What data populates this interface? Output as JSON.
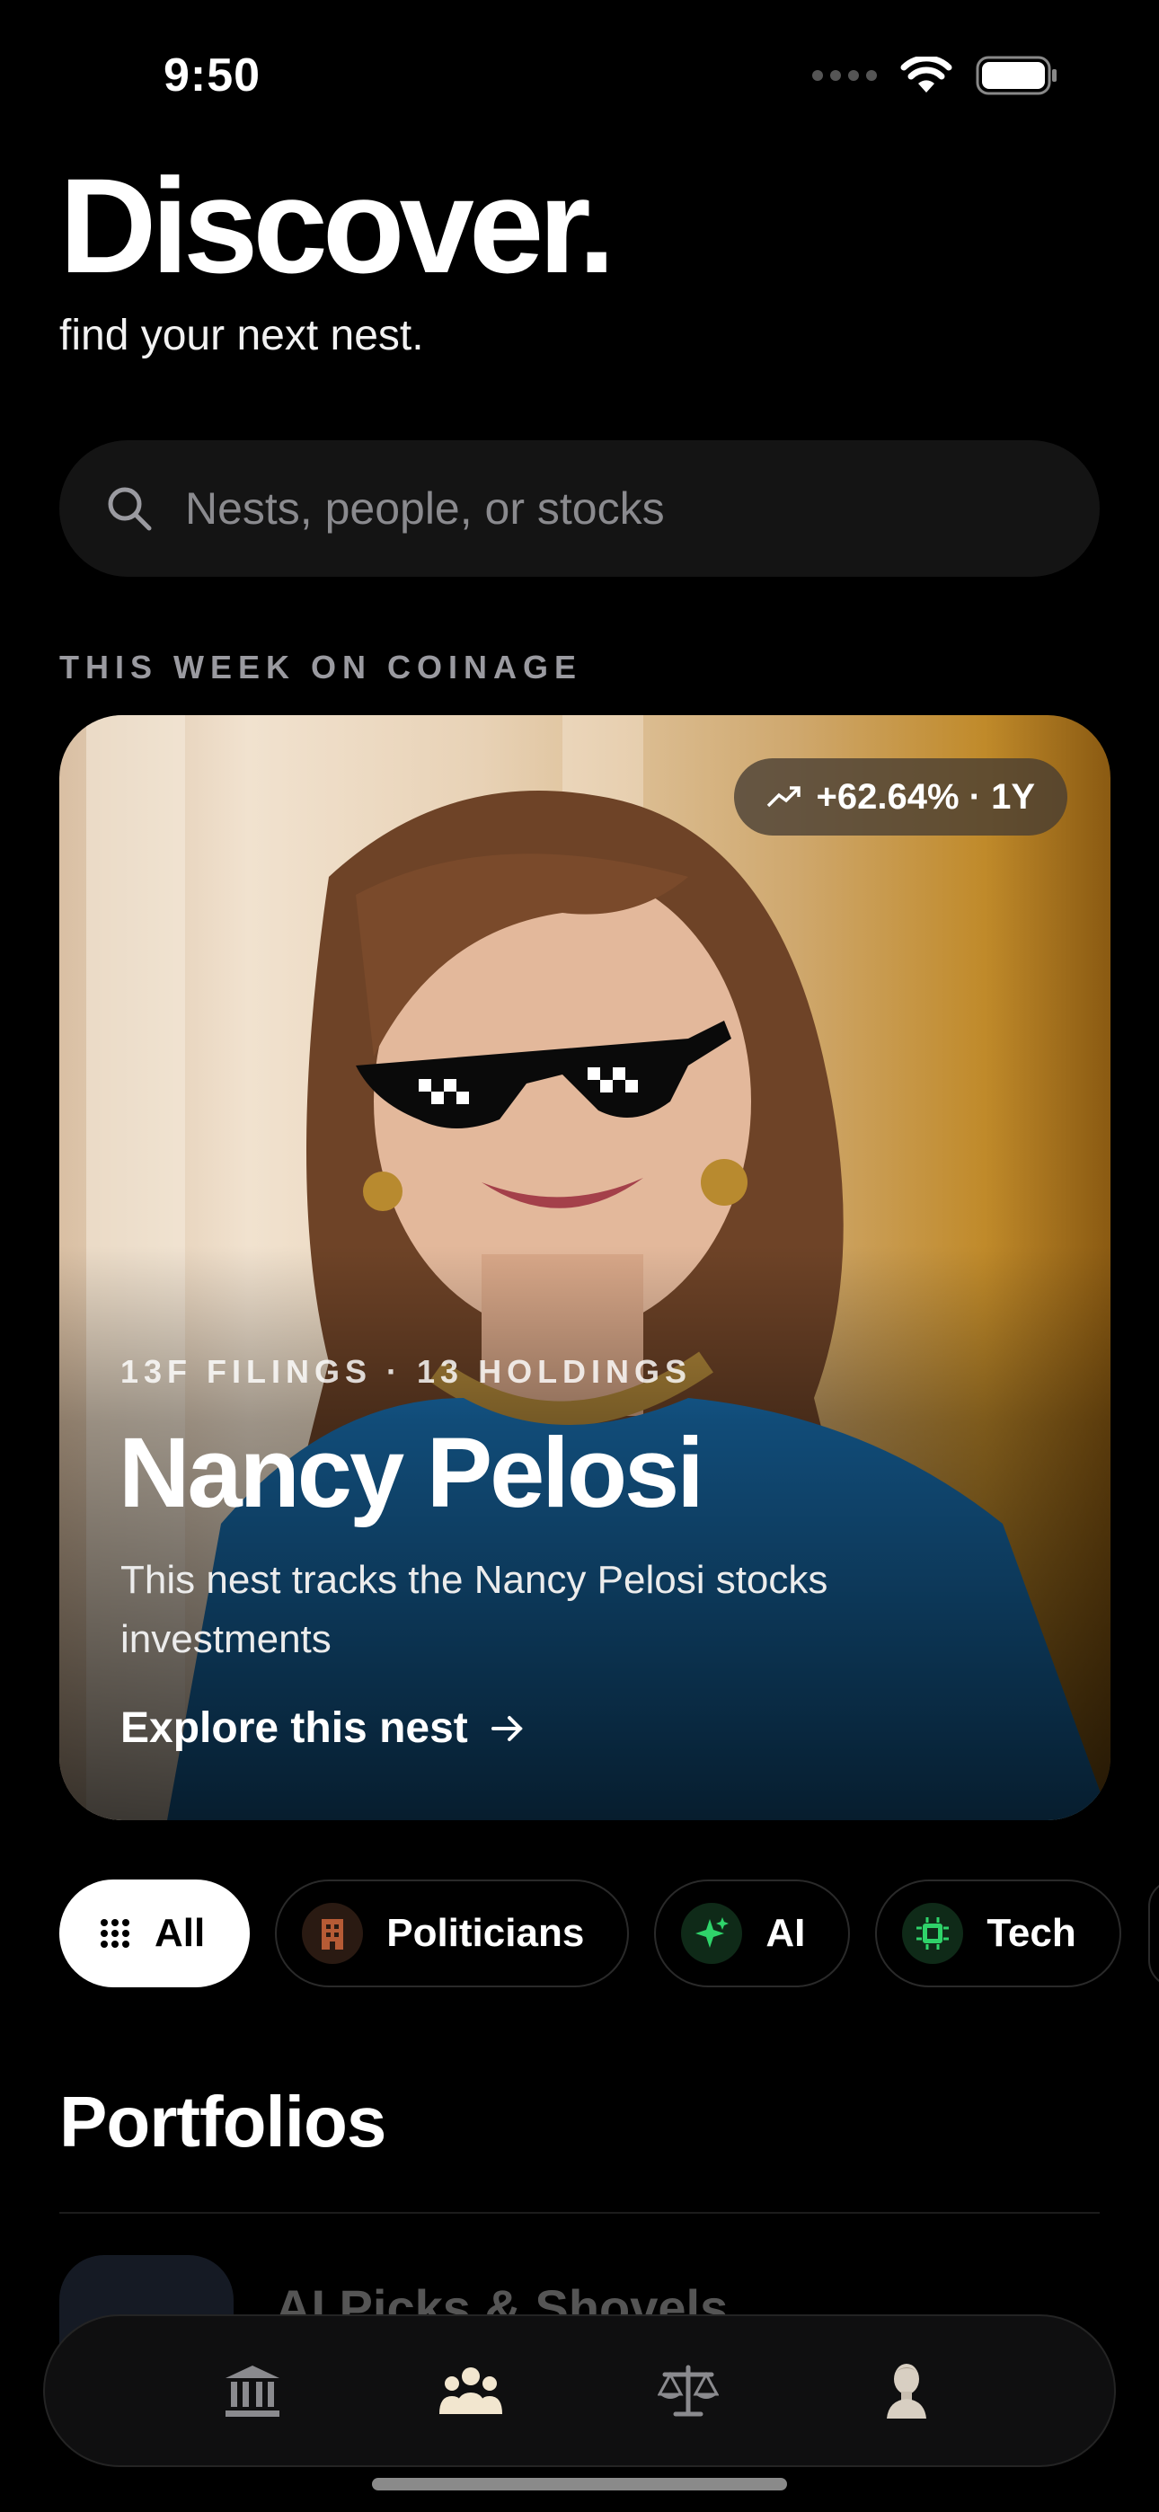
{
  "status_bar": {
    "time": "9:50"
  },
  "header": {
    "title": "Discover.",
    "subtitle": "find your next nest."
  },
  "search": {
    "placeholder": "Nests, people, or stocks"
  },
  "featured": {
    "section_label": "THIS WEEK ON COINAGE",
    "badge": "+62.64% · 1Y",
    "meta": "13F FILINGS · 13 HOLDINGS",
    "name": "Nancy Pelosi",
    "description": "This nest tracks the Nancy Pelosi stocks investments",
    "link": "Explore this nest"
  },
  "filters": [
    {
      "label": "All",
      "icon": "grid-icon",
      "active": true
    },
    {
      "label": "Politicians",
      "icon": "building-icon"
    },
    {
      "label": "AI",
      "icon": "sparkles-icon"
    },
    {
      "label": "Tech",
      "icon": "chip-icon"
    }
  ],
  "portfolios": {
    "heading": "Portfolios",
    "first_item": "AI Picks & Shovels"
  },
  "tabbar": [
    "bank-icon",
    "people-icon",
    "scale-icon",
    "statue-icon"
  ],
  "colors": {
    "background": "#000000",
    "chip_active": "#ffffff",
    "accent_green": "#2fd36a"
  }
}
